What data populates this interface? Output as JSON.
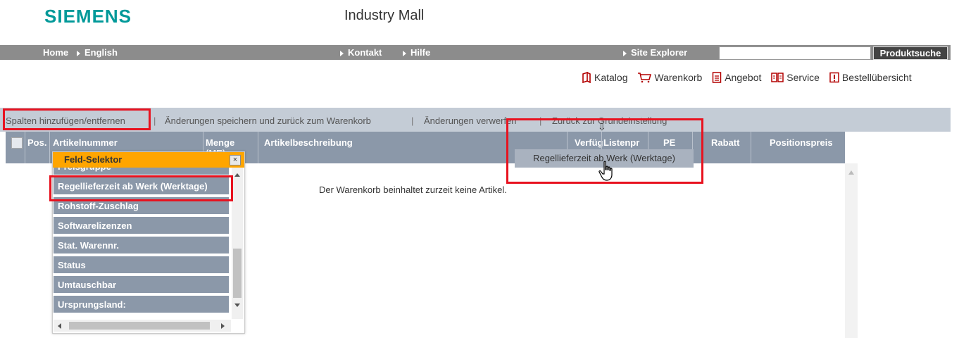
{
  "brand": {
    "logo": "SIEMENS",
    "site_title": "Industry Mall"
  },
  "topnav": {
    "home": "Home",
    "language": "English",
    "contact": "Kontakt",
    "help": "Hilfe",
    "site_explorer": "Site Explorer",
    "search_value": "",
    "search_button": "Produktsuche"
  },
  "quicklinks": [
    {
      "icon": "catalog-icon",
      "label": "Katalog"
    },
    {
      "icon": "cart-icon",
      "label": "Warenkorb"
    },
    {
      "icon": "document-icon",
      "label": "Angebot"
    },
    {
      "icon": "book-icon",
      "label": "Service"
    },
    {
      "icon": "warning-icon",
      "label": "Bestellübersicht"
    }
  ],
  "actionbar": {
    "add_remove_columns": "Spalten hinzufügen/entfernen",
    "save_and_back": "Änderungen speichern und zurück zum Warenkorb",
    "discard": "Änderungen verwerfen",
    "reset": "Zurück zur Grundeinstellung",
    "separator": "|"
  },
  "table": {
    "columns": {
      "pos": "Pos.",
      "article_number": "Artikelnummer",
      "quantity": "Menge",
      "quantity_unit": "(ME)",
      "description": "Artikelbeschreibung",
      "availability": "Verfüg",
      "list_price": "Listenpr",
      "pe": "PE",
      "discount": "Rabatt",
      "position_price": "Positionspreis"
    },
    "empty_message": "Der Warenkorb beinhaltet zurzeit keine Artikel."
  },
  "field_selector": {
    "title": "Feld-Selektor",
    "close": "×",
    "items": [
      "Preisgruppe",
      "Regellieferzeit ab Werk (Werktage)",
      "Rohstoff-Zuschlag",
      "Softwarelizenzen",
      "Stat. Warennr.",
      "Status",
      "Umtauschbar",
      "Ursprungsland:"
    ]
  },
  "drag_ghost": {
    "label": "Regellieferzeit ab Werk (Werktage)"
  },
  "colors": {
    "brand": "#009999",
    "nav": "#8c8c8c",
    "header": "#8b98a9",
    "highlight": "#e8121f",
    "selector": "#ffa500"
  }
}
